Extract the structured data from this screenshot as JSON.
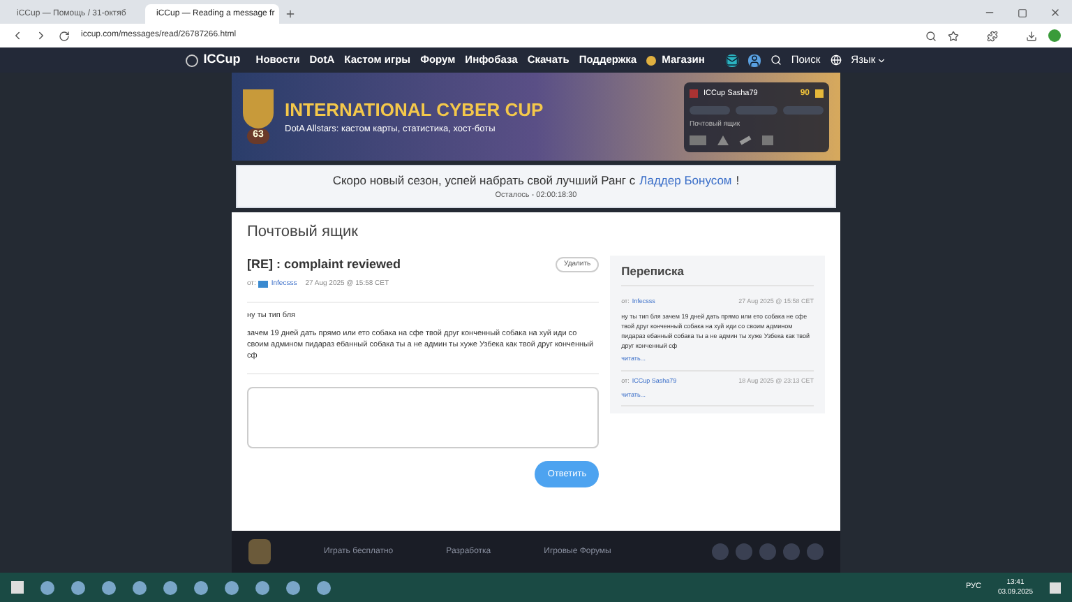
{
  "browser": {
    "tabs": [
      {
        "label": "iCCup — Помощь / 31-октяб",
        "selected": false
      },
      {
        "label": "iCCup — Reading a message fr",
        "selected": true
      }
    ],
    "url": "iccup.com/messages/read/26787266.html"
  },
  "nav": {
    "logo": "ICCup",
    "items": [
      {
        "label": "Новости"
      },
      {
        "label": "DotA"
      },
      {
        "label": "Кастом игры"
      },
      {
        "label": "Форум"
      },
      {
        "label": "Инфобаза"
      },
      {
        "label": "Скачать"
      },
      {
        "label": "Поддержка"
      },
      {
        "label": "Магазин",
        "kind": "shop"
      }
    ],
    "search": "Поиск",
    "language": "Язык"
  },
  "banner": {
    "title": "INTERNATIONAL CYBER CUP",
    "subtitle": "DotA Allstars: кастом карты, статистика, хост-боты",
    "rank": "63",
    "user": {
      "name": "ICCup Sasha79",
      "coins": "90",
      "mail_label": "Почтовый ящик"
    }
  },
  "notice": {
    "text_before": "Скоро новый сезон, успей набрать свой лучший Ранг с",
    "link": "Ладдер Бонусом",
    "text_after": "!",
    "countdown": "Осталось - 02:00:18:30"
  },
  "page_title": "Почтовый ящик",
  "message": {
    "title": "[RE] : complaint reviewed",
    "delete": "Удалить",
    "from_label": "от:",
    "from": "Infecsss",
    "date": "27 Aug 2025 @ 15:58 CET",
    "paragraphs": [
      "ну ты тип бля",
      "зачем 19 дней дать прямо или ето собака на сфе твой друг конченный собака на хуй иди со своим админом пидараз ебанный собака ты а не админ ты хуже Узбека как твой друг конченный сф"
    ],
    "reply": "Ответить"
  },
  "thread": {
    "title": "Переписка",
    "items": [
      {
        "from_label": "от:",
        "from": "Infecsss",
        "date": "27 Aug 2025 @ 15:58 CET",
        "text": "ну ты тип бля зачем 19 дней дать прямо или ето собака не сфе твой друг конченный собака на хуй иди со своим админом пидараз ебанный собака ты а не админ ты хуже Узбека как твой друг конченный сф",
        "read": "читать..."
      },
      {
        "from_label": "от:",
        "from": "ICCup Sasha79",
        "date": "18 Aug 2025 @ 23:13 CET",
        "read": "читать..."
      }
    ]
  },
  "footer": {
    "links": [
      "Играть бесплатно",
      "Разработка",
      "Игровые Форумы"
    ]
  },
  "taskbar": {
    "lang": "РУС",
    "time": "13:41",
    "date": "03.09.2025"
  }
}
